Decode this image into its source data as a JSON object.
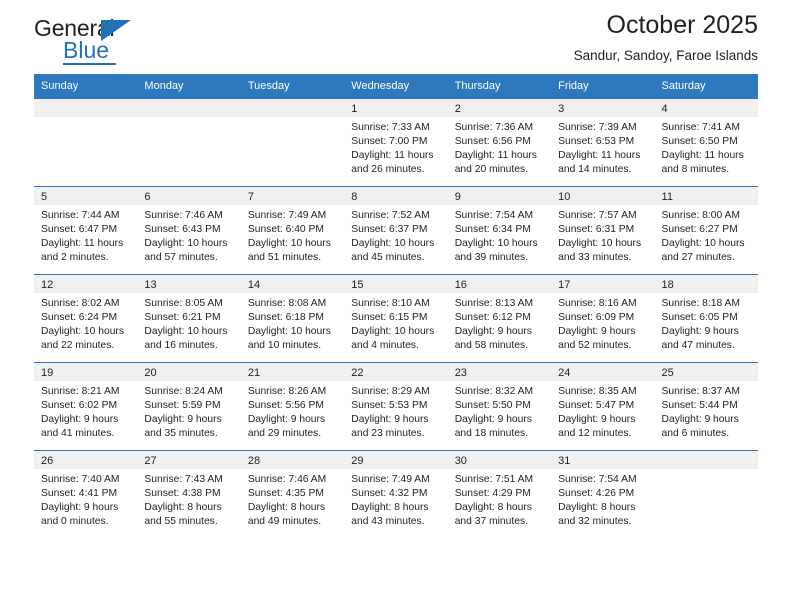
{
  "logo": {
    "word_top": "General",
    "word_bottom": "Blue",
    "accent_color": "#2272b8"
  },
  "header": {
    "title": "October 2025",
    "subtitle": "Sandur, Sandoy, Faroe Islands",
    "header_bg_color": "#2e78bd"
  },
  "weekday_headers": [
    "Sunday",
    "Monday",
    "Tuesday",
    "Wednesday",
    "Thursday",
    "Friday",
    "Saturday"
  ],
  "labels": {
    "sunrise": "Sunrise:",
    "sunset": "Sunset:",
    "daylight": "Daylight:"
  },
  "weeks": [
    [
      {
        "day": "",
        "empty": true
      },
      {
        "day": "",
        "empty": true
      },
      {
        "day": "",
        "empty": true
      },
      {
        "day": "1",
        "sunrise": "Sunrise: 7:33 AM",
        "sunset": "Sunset: 7:00 PM",
        "daylight_1": "Daylight: 11 hours",
        "daylight_2": "and 26 minutes."
      },
      {
        "day": "2",
        "sunrise": "Sunrise: 7:36 AM",
        "sunset": "Sunset: 6:56 PM",
        "daylight_1": "Daylight: 11 hours",
        "daylight_2": "and 20 minutes."
      },
      {
        "day": "3",
        "sunrise": "Sunrise: 7:39 AM",
        "sunset": "Sunset: 6:53 PM",
        "daylight_1": "Daylight: 11 hours",
        "daylight_2": "and 14 minutes."
      },
      {
        "day": "4",
        "sunrise": "Sunrise: 7:41 AM",
        "sunset": "Sunset: 6:50 PM",
        "daylight_1": "Daylight: 11 hours",
        "daylight_2": "and 8 minutes."
      }
    ],
    [
      {
        "day": "5",
        "sunrise": "Sunrise: 7:44 AM",
        "sunset": "Sunset: 6:47 PM",
        "daylight_1": "Daylight: 11 hours",
        "daylight_2": "and 2 minutes."
      },
      {
        "day": "6",
        "sunrise": "Sunrise: 7:46 AM",
        "sunset": "Sunset: 6:43 PM",
        "daylight_1": "Daylight: 10 hours",
        "daylight_2": "and 57 minutes."
      },
      {
        "day": "7",
        "sunrise": "Sunrise: 7:49 AM",
        "sunset": "Sunset: 6:40 PM",
        "daylight_1": "Daylight: 10 hours",
        "daylight_2": "and 51 minutes."
      },
      {
        "day": "8",
        "sunrise": "Sunrise: 7:52 AM",
        "sunset": "Sunset: 6:37 PM",
        "daylight_1": "Daylight: 10 hours",
        "daylight_2": "and 45 minutes."
      },
      {
        "day": "9",
        "sunrise": "Sunrise: 7:54 AM",
        "sunset": "Sunset: 6:34 PM",
        "daylight_1": "Daylight: 10 hours",
        "daylight_2": "and 39 minutes."
      },
      {
        "day": "10",
        "sunrise": "Sunrise: 7:57 AM",
        "sunset": "Sunset: 6:31 PM",
        "daylight_1": "Daylight: 10 hours",
        "daylight_2": "and 33 minutes."
      },
      {
        "day": "11",
        "sunrise": "Sunrise: 8:00 AM",
        "sunset": "Sunset: 6:27 PM",
        "daylight_1": "Daylight: 10 hours",
        "daylight_2": "and 27 minutes."
      }
    ],
    [
      {
        "day": "12",
        "sunrise": "Sunrise: 8:02 AM",
        "sunset": "Sunset: 6:24 PM",
        "daylight_1": "Daylight: 10 hours",
        "daylight_2": "and 22 minutes."
      },
      {
        "day": "13",
        "sunrise": "Sunrise: 8:05 AM",
        "sunset": "Sunset: 6:21 PM",
        "daylight_1": "Daylight: 10 hours",
        "daylight_2": "and 16 minutes."
      },
      {
        "day": "14",
        "sunrise": "Sunrise: 8:08 AM",
        "sunset": "Sunset: 6:18 PM",
        "daylight_1": "Daylight: 10 hours",
        "daylight_2": "and 10 minutes."
      },
      {
        "day": "15",
        "sunrise": "Sunrise: 8:10 AM",
        "sunset": "Sunset: 6:15 PM",
        "daylight_1": "Daylight: 10 hours",
        "daylight_2": "and 4 minutes."
      },
      {
        "day": "16",
        "sunrise": "Sunrise: 8:13 AM",
        "sunset": "Sunset: 6:12 PM",
        "daylight_1": "Daylight: 9 hours",
        "daylight_2": "and 58 minutes."
      },
      {
        "day": "17",
        "sunrise": "Sunrise: 8:16 AM",
        "sunset": "Sunset: 6:09 PM",
        "daylight_1": "Daylight: 9 hours",
        "daylight_2": "and 52 minutes."
      },
      {
        "day": "18",
        "sunrise": "Sunrise: 8:18 AM",
        "sunset": "Sunset: 6:05 PM",
        "daylight_1": "Daylight: 9 hours",
        "daylight_2": "and 47 minutes."
      }
    ],
    [
      {
        "day": "19",
        "sunrise": "Sunrise: 8:21 AM",
        "sunset": "Sunset: 6:02 PM",
        "daylight_1": "Daylight: 9 hours",
        "daylight_2": "and 41 minutes."
      },
      {
        "day": "20",
        "sunrise": "Sunrise: 8:24 AM",
        "sunset": "Sunset: 5:59 PM",
        "daylight_1": "Daylight: 9 hours",
        "daylight_2": "and 35 minutes."
      },
      {
        "day": "21",
        "sunrise": "Sunrise: 8:26 AM",
        "sunset": "Sunset: 5:56 PM",
        "daylight_1": "Daylight: 9 hours",
        "daylight_2": "and 29 minutes."
      },
      {
        "day": "22",
        "sunrise": "Sunrise: 8:29 AM",
        "sunset": "Sunset: 5:53 PM",
        "daylight_1": "Daylight: 9 hours",
        "daylight_2": "and 23 minutes."
      },
      {
        "day": "23",
        "sunrise": "Sunrise: 8:32 AM",
        "sunset": "Sunset: 5:50 PM",
        "daylight_1": "Daylight: 9 hours",
        "daylight_2": "and 18 minutes."
      },
      {
        "day": "24",
        "sunrise": "Sunrise: 8:35 AM",
        "sunset": "Sunset: 5:47 PM",
        "daylight_1": "Daylight: 9 hours",
        "daylight_2": "and 12 minutes."
      },
      {
        "day": "25",
        "sunrise": "Sunrise: 8:37 AM",
        "sunset": "Sunset: 5:44 PM",
        "daylight_1": "Daylight: 9 hours",
        "daylight_2": "and 6 minutes."
      }
    ],
    [
      {
        "day": "26",
        "sunrise": "Sunrise: 7:40 AM",
        "sunset": "Sunset: 4:41 PM",
        "daylight_1": "Daylight: 9 hours",
        "daylight_2": "and 0 minutes."
      },
      {
        "day": "27",
        "sunrise": "Sunrise: 7:43 AM",
        "sunset": "Sunset: 4:38 PM",
        "daylight_1": "Daylight: 8 hours",
        "daylight_2": "and 55 minutes."
      },
      {
        "day": "28",
        "sunrise": "Sunrise: 7:46 AM",
        "sunset": "Sunset: 4:35 PM",
        "daylight_1": "Daylight: 8 hours",
        "daylight_2": "and 49 minutes."
      },
      {
        "day": "29",
        "sunrise": "Sunrise: 7:49 AM",
        "sunset": "Sunset: 4:32 PM",
        "daylight_1": "Daylight: 8 hours",
        "daylight_2": "and 43 minutes."
      },
      {
        "day": "30",
        "sunrise": "Sunrise: 7:51 AM",
        "sunset": "Sunset: 4:29 PM",
        "daylight_1": "Daylight: 8 hours",
        "daylight_2": "and 37 minutes."
      },
      {
        "day": "31",
        "sunrise": "Sunrise: 7:54 AM",
        "sunset": "Sunset: 4:26 PM",
        "daylight_1": "Daylight: 8 hours",
        "daylight_2": "and 32 minutes."
      },
      {
        "day": "",
        "empty": true
      }
    ]
  ]
}
